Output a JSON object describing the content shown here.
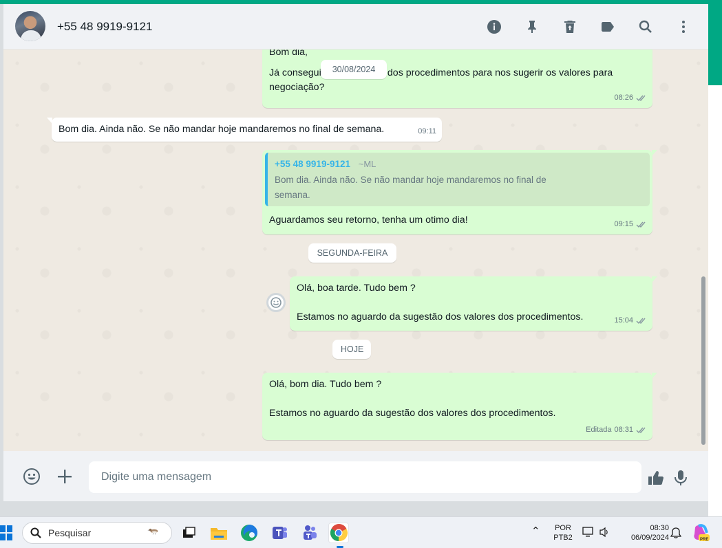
{
  "contact": {
    "name": "+55 48 9919-9121"
  },
  "header_icons": [
    "info-icon",
    "pin-icon",
    "delete-icon",
    "label-icon",
    "search-icon",
    "menu-icon"
  ],
  "messages": {
    "m1": {
      "text_top": "Bom dia,",
      "text": "Já consegui ver os valores dos procedimentos para nos sugerir os valores para negociação?",
      "time": "08:26"
    },
    "date_pill": "30/08/2024",
    "m2": {
      "text": "Bom dia. Ainda não. Se não mandar hoje mandaremos no final de semana.",
      "time": "09:11"
    },
    "m3": {
      "quote_name": "+55 48 9919-9121",
      "quote_sub": "~ML",
      "quote_text": "Bom dia. Ainda não. Se não mandar hoje mandaremos no final de semana.",
      "text": "Aguardamos seu retorno, tenha um otimo dia!",
      "time": "09:15"
    },
    "day_monday": "SEGUNDA-FEIRA",
    "m4": {
      "line1": "Olá, boa tarde. Tudo bem ?",
      "line2": "Estamos no aguardo da sugestão dos valores dos procedimentos.",
      "time": "15:04"
    },
    "day_today": "HOJE",
    "m5": {
      "line1": "Olá, bom dia. Tudo bem ?",
      "line2": "Estamos no aguardo da sugestão dos valores dos procedimentos.",
      "edited": "Editada",
      "time": "08:31"
    }
  },
  "composer": {
    "placeholder": "Digite uma mensagem"
  },
  "taskbar": {
    "search_label": "Pesquisar",
    "lang_top": "POR",
    "lang_bottom": "PTB2",
    "time": "08:30",
    "date": "06/09/2024",
    "copilot_badge": "PRE"
  },
  "colors": {
    "outgoing": "#d9fdd3",
    "incoming": "#ffffff",
    "accent": "#00a884",
    "quote_bar": "#35b4e8"
  }
}
